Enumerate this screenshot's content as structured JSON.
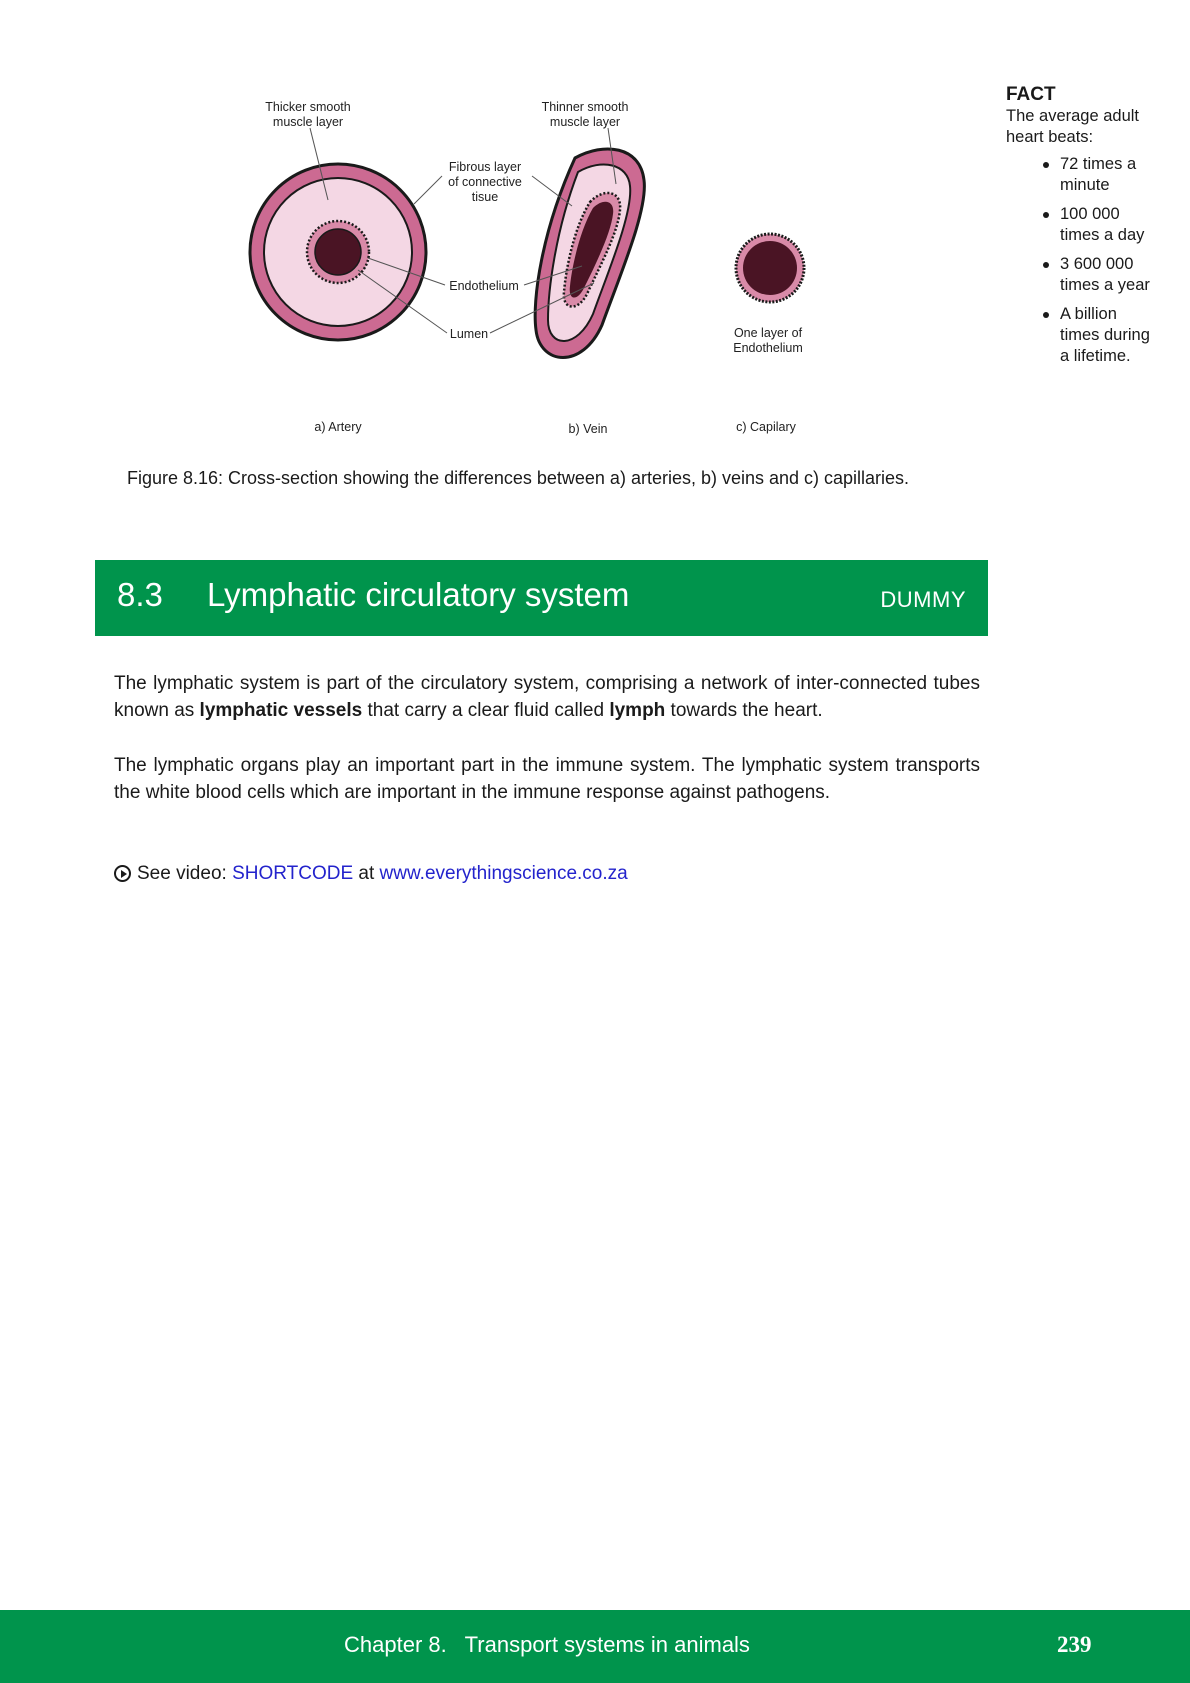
{
  "figure": {
    "labels": {
      "thicker_smooth_muscle": "Thicker smooth\nmuscle layer",
      "thinner_smooth_muscle": "Thinner smooth\nmuscle layer",
      "fibrous_layer": "Fibrous layer\nof connective\ntisue",
      "endothelium": "Endothelium",
      "lumen": "Lumen",
      "one_layer_endothelium": "One layer of\nEndothelium",
      "artery": "a) Artery",
      "vein": "b) Vein",
      "capillary": "c) Capilary"
    },
    "caption": "Figure 8.16: Cross-section showing the differences between a) arteries, b) veins and c) capillaries.",
    "colors": {
      "outer_wall": "#cc6a92",
      "muscle_layer": "#f4d7e4",
      "lumen": "#4a1424",
      "endothelium": "#d98aa8"
    }
  },
  "fact": {
    "title": "FACT",
    "intro": "The average adult heart beats:",
    "items": [
      "72 times a minute",
      "100 000 times a day",
      "3 600 000 times a year",
      "A billion times during a lifetime."
    ]
  },
  "section": {
    "number": "8.3",
    "title": "Lymphatic circulatory system",
    "tag": "DUMMY"
  },
  "body": {
    "p1": {
      "t1": "The lymphatic system is part of the circulatory system, comprising a network of inter-connected tubes known as ",
      "b1": "lymphatic vessels",
      "t2": " that carry a clear fluid called ",
      "b2": "lymph",
      "t3": " towards the heart."
    },
    "p2": "The lymphatic organs play an important part in the immune system. The lymphatic system transports the white blood cells which are important in the immune response against pathogens."
  },
  "video": {
    "prefix": "See video: ",
    "shortcode": "SHORTCODE",
    "middle": " at ",
    "url": "www.everythingscience.co.za"
  },
  "footer": {
    "chapter": "Chapter 8.   Transport systems in animals",
    "page": "239"
  },
  "colors": {
    "green": "#00944c",
    "link": "#2323cc"
  }
}
